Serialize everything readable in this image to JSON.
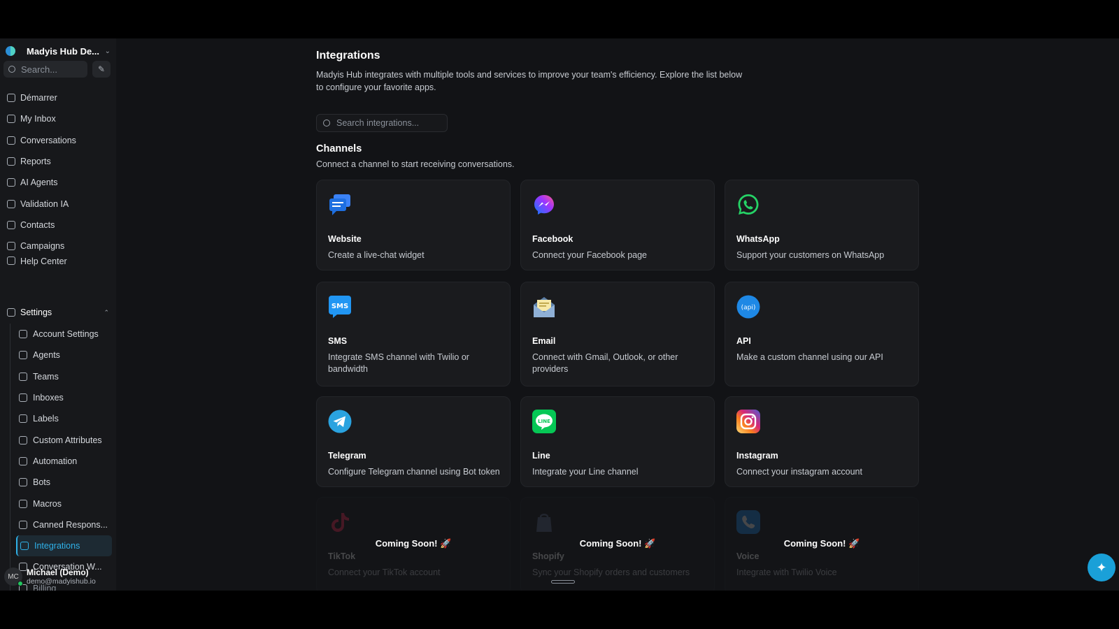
{
  "workspace": {
    "name": "Madyis Hub De..."
  },
  "sidebar": {
    "search_placeholder": "Search...",
    "nav": [
      "Démarrer",
      "My Inbox",
      "Conversations",
      "Reports",
      "AI Agents",
      "Validation IA",
      "Contacts",
      "Campaigns",
      "Help Center"
    ],
    "settings_label": "Settings",
    "settings_items": [
      "Account Settings",
      "Agents",
      "Teams",
      "Inboxes",
      "Labels",
      "Custom Attributes",
      "Automation",
      "Bots",
      "Macros",
      "Canned Respons...",
      "Integrations",
      "Conversation W...",
      "Billing"
    ],
    "user": {
      "initials": "MC",
      "name": "Michael (Demo)",
      "email": "demo@madyishub.io"
    }
  },
  "main": {
    "title": "Integrations",
    "description": "Madyis Hub integrates with multiple tools and services to improve your team's efficiency. Explore the list below to configure your favorite apps.",
    "search_placeholder": "Search integrations...",
    "section_title": "Channels",
    "section_desc": "Connect a channel to start receiving conversations.",
    "cards": [
      {
        "title": "Website",
        "desc": "Create a live-chat widget",
        "icon": "website-chat-icon"
      },
      {
        "title": "Facebook",
        "desc": "Connect your Facebook page",
        "icon": "messenger-icon"
      },
      {
        "title": "WhatsApp",
        "desc": "Support your customers on WhatsApp",
        "icon": "whatsapp-icon"
      },
      {
        "title": "SMS",
        "desc": "Integrate SMS channel with Twilio or bandwidth",
        "icon": "sms-icon"
      },
      {
        "title": "Email",
        "desc": "Connect with Gmail, Outlook, or other providers",
        "icon": "email-icon"
      },
      {
        "title": "API",
        "desc": "Make a custom channel using our API",
        "icon": "api-icon"
      },
      {
        "title": "Telegram",
        "desc": "Configure Telegram channel using Bot token",
        "icon": "telegram-icon"
      },
      {
        "title": "Line",
        "desc": "Integrate your Line channel",
        "icon": "line-icon"
      },
      {
        "title": "Instagram",
        "desc": "Connect your instagram account",
        "icon": "instagram-icon"
      }
    ],
    "coming_soon": [
      {
        "title": "TikTok",
        "desc": "Connect your TikTok account",
        "label": "Coming Soon! 🚀"
      },
      {
        "title": "Shopify",
        "desc": "Sync your Shopify orders and customers",
        "label": "Coming Soon! 🚀"
      },
      {
        "title": "Voice",
        "desc": "Integrate with Twilio Voice",
        "label": "Coming Soon! 🚀"
      }
    ]
  },
  "icons": {
    "sparkle": "✦",
    "compose": "✎",
    "chevron_down": "⌄",
    "chevron_up": "⌃"
  }
}
